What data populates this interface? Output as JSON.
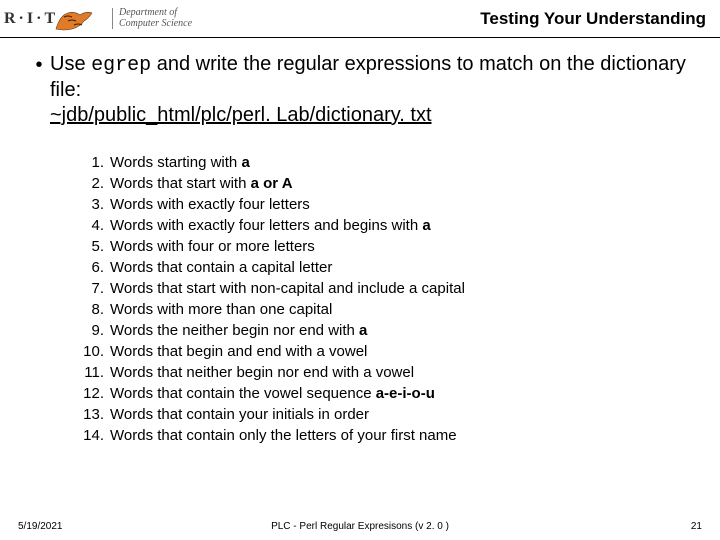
{
  "header": {
    "rit": "R·I·T",
    "dept1": "Department of",
    "dept2": "Computer Science",
    "title": "Testing Your Understanding"
  },
  "main": {
    "bullet": "•",
    "line1a": "Use ",
    "code": "egrep",
    "line1b": " and write the regular expressions to match on the dictionary file:",
    "path": "~jdb/public_html/plc/perl. Lab/dictionary. txt"
  },
  "items": [
    {
      "n": "1.",
      "t": "Words starting with ",
      "b": "a",
      "t2": ""
    },
    {
      "n": "2.",
      "t": "Words that start with ",
      "b": "a or A",
      "t2": ""
    },
    {
      "n": "3.",
      "t": "Words with exactly four letters",
      "b": "",
      "t2": ""
    },
    {
      "n": "4.",
      "t": "Words with exactly four letters and begins with ",
      "b": "a",
      "t2": ""
    },
    {
      "n": "5.",
      "t": "Words with four or more letters",
      "b": "",
      "t2": ""
    },
    {
      "n": "6.",
      "t": "Words that contain a capital letter",
      "b": "",
      "t2": ""
    },
    {
      "n": "7.",
      "t": "Words that start with non-capital and include a capital",
      "b": "",
      "t2": ""
    },
    {
      "n": "8.",
      "t": "Words with more than one capital",
      "b": "",
      "t2": ""
    },
    {
      "n": "9.",
      "t": "Words the neither begin nor end with ",
      "b": "a",
      "t2": ""
    },
    {
      "n": "10.",
      "t": "Words that begin and end with a vowel",
      "b": "",
      "t2": ""
    },
    {
      "n": "11.",
      "t": "Words that neither begin nor end with a vowel",
      "b": "",
      "t2": ""
    },
    {
      "n": "12.",
      "t": "Words that contain the vowel sequence ",
      "b": "a-e-i-o-u",
      "t2": ""
    },
    {
      "n": "13.",
      "t": "Words that contain your initials in order",
      "b": "",
      "t2": ""
    },
    {
      "n": "14.",
      "t": "Words that contain only the letters of your first name",
      "b": "",
      "t2": ""
    }
  ],
  "footer": {
    "date": "5/19/2021",
    "center": "PLC - Perl Regular Expresisons  (v 2. 0 )",
    "page": "21"
  }
}
